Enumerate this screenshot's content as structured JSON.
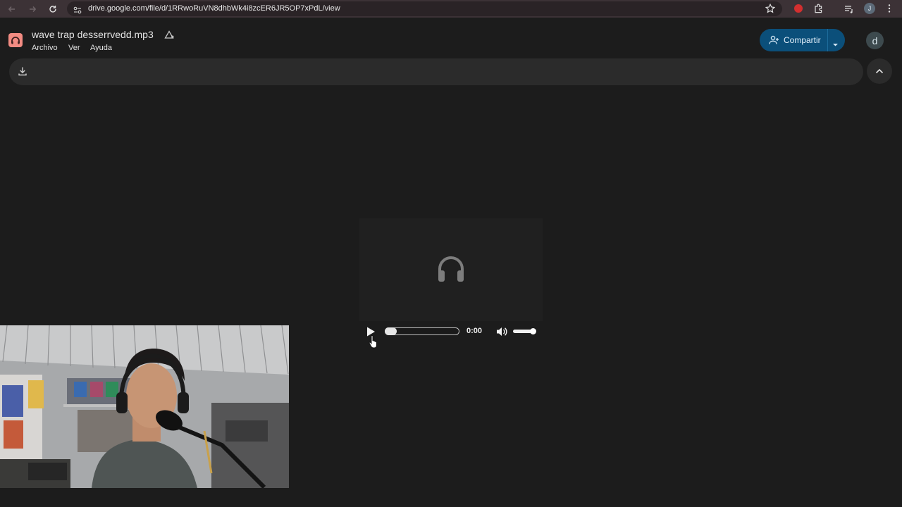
{
  "browser": {
    "url": "drive.google.com/file/d/1RRwoRuVN8dhbWk4i8zcER6JR5OP7xPdL/view",
    "profile_initial": "J"
  },
  "drive": {
    "file_name": "wave trap desserrvedd.mp3",
    "menu": [
      "Archivo",
      "Ver",
      "Ayuda"
    ],
    "share_label": "Compartir",
    "account_initial": "d",
    "accent": "#0b4f7a"
  },
  "player": {
    "current_time": "0:00",
    "progress": 0,
    "volume": 1.0,
    "state": "paused",
    "center_icon": "headphones-icon"
  },
  "overlay": {
    "webcam_feed": "person-with-headphones-and-microphone"
  }
}
